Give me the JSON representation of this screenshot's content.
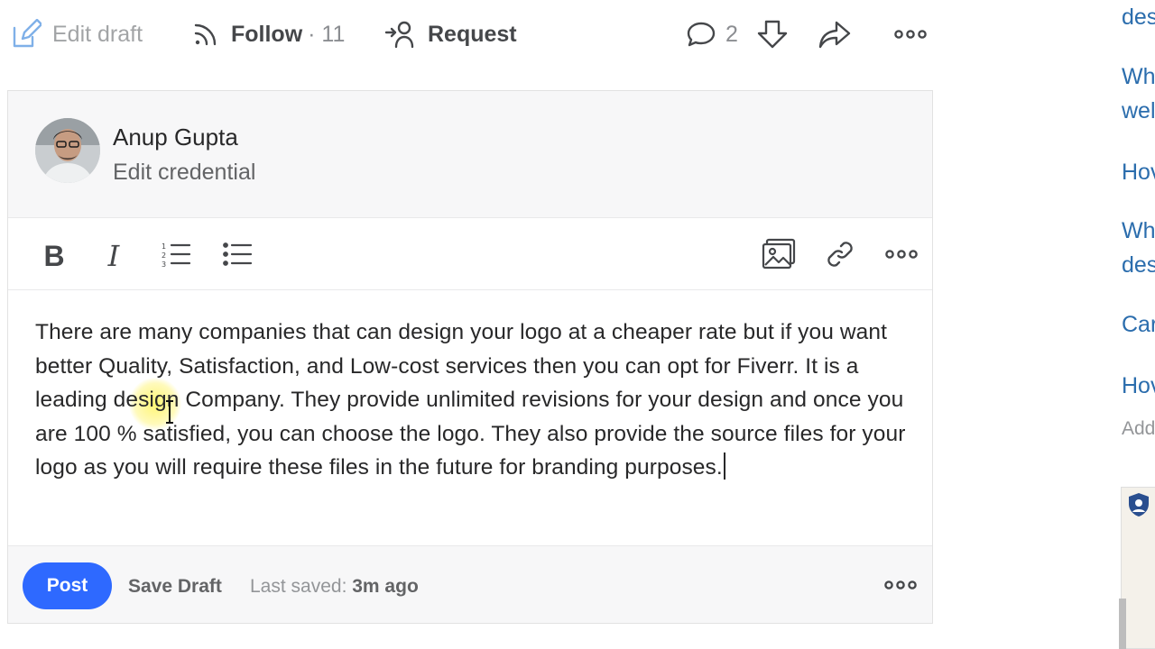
{
  "action_bar": {
    "edit_draft": "Edit draft",
    "follow_label": "Follow",
    "follow_count": "· 11",
    "request_label": "Request",
    "comment_count": "2",
    "icons": {
      "edit": "pencil-icon",
      "follow": "rss-icon",
      "request": "request-icon",
      "comment": "comment-icon",
      "downvote": "downvote-icon",
      "share": "share-icon",
      "more": "more-icon"
    }
  },
  "editor": {
    "author_name": "Anup Gupta",
    "credential": "Edit credential",
    "toolbar": {
      "bold": "B",
      "italic": "I",
      "icons": [
        "numbered-list-icon",
        "bulleted-list-icon",
        "image-icon",
        "link-icon",
        "more-icon"
      ]
    },
    "answer_text": "There are many companies that can design your logo at a cheaper rate but if you want better Quality, Satisfaction, and Low-cost services then you can opt for Fiverr. It is a leading design Company. They provide unlimited revisions for your design and once you are 100 % satisfied, you can choose the logo. They also provide the source files for your logo as you will require these files in the future for branding purposes.",
    "footer": {
      "post": "Post",
      "save_draft": "Save Draft",
      "last_saved_label": "Last saved:",
      "last_saved_value": "3m ago"
    }
  },
  "sidebar": {
    "links": [
      "des",
      "Wh",
      "wel",
      "Hov",
      "Wh",
      "des",
      "Car",
      "Hov"
    ],
    "add": "Add"
  },
  "colors": {
    "accent": "#2e69ff",
    "link": "#2b6dad",
    "muted": "#636466"
  }
}
